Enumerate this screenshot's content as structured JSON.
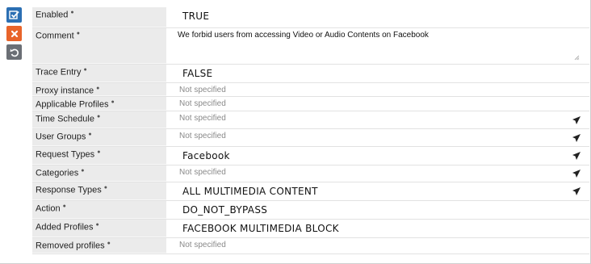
{
  "fields": {
    "enabled": {
      "label": "Enabled",
      "value": "TRUE"
    },
    "comment": {
      "label": "Comment",
      "value": "We forbid users from accessing Video or Audio Contents on Facebook"
    },
    "trace_entry": {
      "label": "Trace Entry",
      "value": "FALSE"
    },
    "proxy_instance": {
      "label": "Proxy instance",
      "value": "Not specified"
    },
    "applicable_profiles": {
      "label": "Applicable Profiles",
      "value": "Not specified"
    },
    "time_schedule": {
      "label": "Time Schedule",
      "value": "Not specified"
    },
    "user_groups": {
      "label": "User Groups",
      "value": "Not specified"
    },
    "request_types": {
      "label": "Request Types",
      "value": "Facebook"
    },
    "categories": {
      "label": "Categories",
      "value": "Not specified"
    },
    "response_types": {
      "label": "Response Types",
      "value": "ALL MULTIMEDIA CONTENT"
    },
    "action": {
      "label": "Action",
      "value": "DO_NOT_BYPASS"
    },
    "added_profiles": {
      "label": "Added Profiles",
      "value": "FACEBOOK MULTIMEDIA BLOCK"
    },
    "removed_profiles": {
      "label": "Removed profiles",
      "value": "Not specified"
    }
  },
  "icons": {
    "save": "checkbox-icon",
    "cancel": "close-icon",
    "reset": "undo-icon",
    "info": "info-icon",
    "select": "send-arrow-icon",
    "resize": "resize-grip-icon"
  },
  "colors": {
    "save_button": "#2b6fb3",
    "cancel_button": "#e8642a",
    "reset_button": "#6b6f75",
    "label_background": "#ebebeb",
    "muted_text": "#8a8a8a"
  }
}
